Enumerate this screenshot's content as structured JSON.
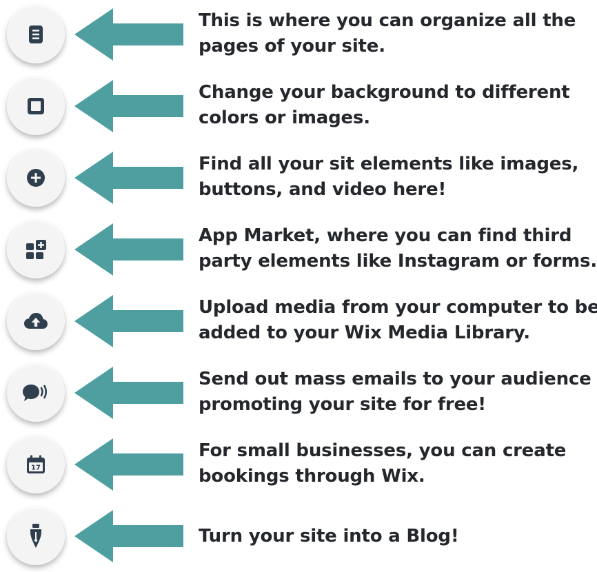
{
  "colors": {
    "arrow": "#4f9fa1",
    "icon": "#2f3f4e",
    "text": "#24272b",
    "button": "#f4f4f4"
  },
  "rows": [
    {
      "icon": "pages-icon",
      "lines": [
        "This is where you can organize all the",
        "pages of your site."
      ]
    },
    {
      "icon": "background-icon",
      "lines": [
        "Change your background to different",
        "colors or images."
      ]
    },
    {
      "icon": "add-plus-icon",
      "lines": [
        "Find all your sit elements like images,",
        "buttons, and video here!"
      ]
    },
    {
      "icon": "app-market-icon",
      "lines": [
        "App Market, where you can find third",
        "party elements like Instagram or forms."
      ]
    },
    {
      "icon": "cloud-upload-icon",
      "lines": [
        "Upload media from your computer to be",
        "added to your Wix Media Library."
      ]
    },
    {
      "icon": "speech-broadcast-icon",
      "lines": [
        "Send out mass emails to your audience",
        "promoting your site for free!"
      ]
    },
    {
      "icon": "calendar-17-icon",
      "lines": [
        "For small businesses, you can create",
        "bookings through Wix."
      ]
    },
    {
      "icon": "pen-nib-icon",
      "lines": [
        "Turn your site into a Blog!"
      ]
    }
  ],
  "calendar_day": "17"
}
